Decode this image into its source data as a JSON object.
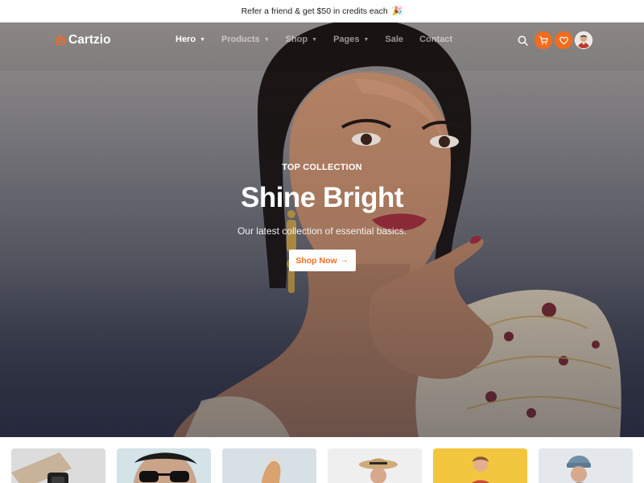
{
  "announcement": {
    "text": "Refer a friend & get $50 in credits each",
    "emoji": "🎉"
  },
  "brand": {
    "name": "Cartzio",
    "accent": "#f36b1c"
  },
  "nav": {
    "items": [
      {
        "label": "Hero",
        "active": true,
        "has_dropdown": true
      },
      {
        "label": "Products",
        "active": false,
        "has_dropdown": true
      },
      {
        "label": "Shop",
        "active": false,
        "has_dropdown": true
      },
      {
        "label": "Pages",
        "active": false,
        "has_dropdown": true
      },
      {
        "label": "Sale",
        "active": false,
        "has_dropdown": false
      },
      {
        "label": "Contact",
        "active": false,
        "has_dropdown": false
      }
    ],
    "actions": [
      "search-icon",
      "cart-icon",
      "heart-icon",
      "user-avatar"
    ]
  },
  "hero": {
    "eyebrow": "TOP COLLECTION",
    "title": "Shine Bright",
    "subtitle": "Our latest collection of essential basics.",
    "cta_label": "Shop Now",
    "cta_icon": "arrow-right-icon"
  },
  "categories": [
    "watch",
    "sunglasses",
    "heels",
    "hat",
    "kids",
    "beanie"
  ]
}
